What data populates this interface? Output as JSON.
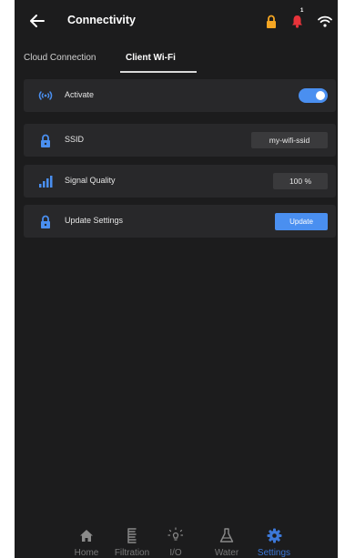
{
  "header": {
    "title": "Connectivity",
    "notification_count": "1",
    "icons": {
      "back": "back-arrow-icon",
      "lock": "lock-icon",
      "bell": "bell-icon",
      "wifi": "wifi-icon"
    }
  },
  "tabs": [
    {
      "label": "Cloud Connection",
      "active": false
    },
    {
      "label": "Client Wi-Fi",
      "active": true
    }
  ],
  "rows": {
    "activate": {
      "label": "Activate",
      "enabled": true,
      "icon": "wifi-signal-icon"
    },
    "ssid": {
      "label": "SSID",
      "value": "my-wifi-ssid",
      "icon": "lock-icon"
    },
    "signal": {
      "label": "Signal Quality",
      "value": "100 %",
      "icon": "signal-bars-icon"
    },
    "update": {
      "label": "Update Settings",
      "button": "Update",
      "icon": "lock-icon"
    }
  },
  "nav": [
    {
      "label": "Home",
      "icon": "home-icon",
      "active": false
    },
    {
      "label": "Filtration",
      "icon": "filtration-icon",
      "active": false
    },
    {
      "label": "I/O",
      "icon": "lightbulb-icon",
      "active": false
    },
    {
      "label": "Water",
      "icon": "flask-icon",
      "active": false
    },
    {
      "label": "Settings",
      "icon": "gear-icon",
      "active": true
    }
  ],
  "colors": {
    "accent": "#4a8ff0",
    "lock_orange": "#f5a623",
    "bell_red": "#e8333a",
    "background": "#1c1c1d",
    "row_background": "#28282a"
  }
}
